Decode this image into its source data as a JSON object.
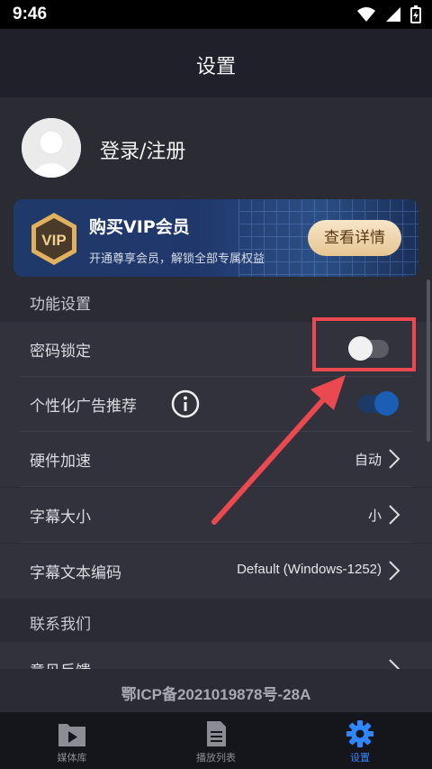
{
  "status_bar": {
    "time": "9:46"
  },
  "header": {
    "title": "设置"
  },
  "profile": {
    "login_label": "登录/注册"
  },
  "vip": {
    "badge_text": "VIP",
    "title": "购买VIP会员",
    "subtitle": "开通尊享会员，解锁全部专属权益",
    "button_label": "查看详情"
  },
  "sections": {
    "function_settings": "功能设置",
    "contact_us": "联系我们"
  },
  "settings": {
    "password_lock": {
      "label": "密码锁定",
      "enabled": false
    },
    "personalized_ads": {
      "label": "个性化广告推荐",
      "enabled": true
    },
    "hardware_accel": {
      "label": "硬件加速",
      "value": "自动"
    },
    "subtitle_size": {
      "label": "字幕大小",
      "value": "小"
    },
    "subtitle_encoding": {
      "label": "字幕文本编码",
      "value": "Default (Windows-1252)"
    },
    "feedback": {
      "label": "意见反馈"
    }
  },
  "footer": {
    "icp": "鄂ICP备2021019878号-28A"
  },
  "tabs": [
    {
      "label": "媒体库",
      "icon": "media-library-icon",
      "active": false
    },
    {
      "label": "播放列表",
      "icon": "playlist-icon",
      "active": false
    },
    {
      "label": "设置",
      "icon": "settings-gear-icon",
      "active": true
    }
  ],
  "colors": {
    "accent": "#2f86ff",
    "toggle_on": "#1a5fb4",
    "highlight": "#ea4a4f",
    "vip_button": "#e6c593"
  }
}
